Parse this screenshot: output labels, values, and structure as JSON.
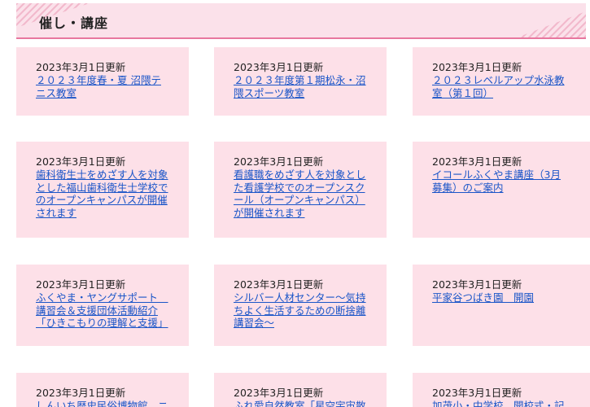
{
  "section": {
    "title": "催し・講座"
  },
  "cards": [
    {
      "date": "2023年3月1日更新",
      "link": "２０２３年度春・夏 沼隈テニス教室"
    },
    {
      "date": "2023年3月1日更新",
      "link": "２０２３年度第１期松永・沼隈スポーツ教室"
    },
    {
      "date": "2023年3月1日更新",
      "link": "２０２３レベルアップ水泳教室（第１回）"
    },
    {
      "date": "2023年3月1日更新",
      "link": "歯科衛生士をめざす人を対象とした福山歯科衛生士学校でのオープンキャンパスが開催されます"
    },
    {
      "date": "2023年3月1日更新",
      "link": "看護職をめざす人を対象とした看護学校でのオープンスクール（オープンキャンパス）が開催されます"
    },
    {
      "date": "2023年3月1日更新",
      "link": "イコールふくやま講座（3月募集）のご案内"
    },
    {
      "date": "2023年3月1日更新",
      "link": "ふくやま・ヤングサポート　講習会＆支援団体活動紹介「ひきこもりの理解と支援」"
    },
    {
      "date": "2023年3月1日更新",
      "link": "シルバー人材センター～気持ちよく生活するための断捨離講習会～"
    },
    {
      "date": "2023年3月1日更新",
      "link": "平家谷つばき園　開園"
    },
    {
      "date": "2023年3月1日更新",
      "link": "しんいち歴史民俗博物館　ニ"
    },
    {
      "date": "2023年3月1日更新",
      "link": "ふれ愛自然教室「星空宇宙散"
    },
    {
      "date": "2023年3月1日更新",
      "link": "加茂小・中学校　開校式・記"
    }
  ]
}
